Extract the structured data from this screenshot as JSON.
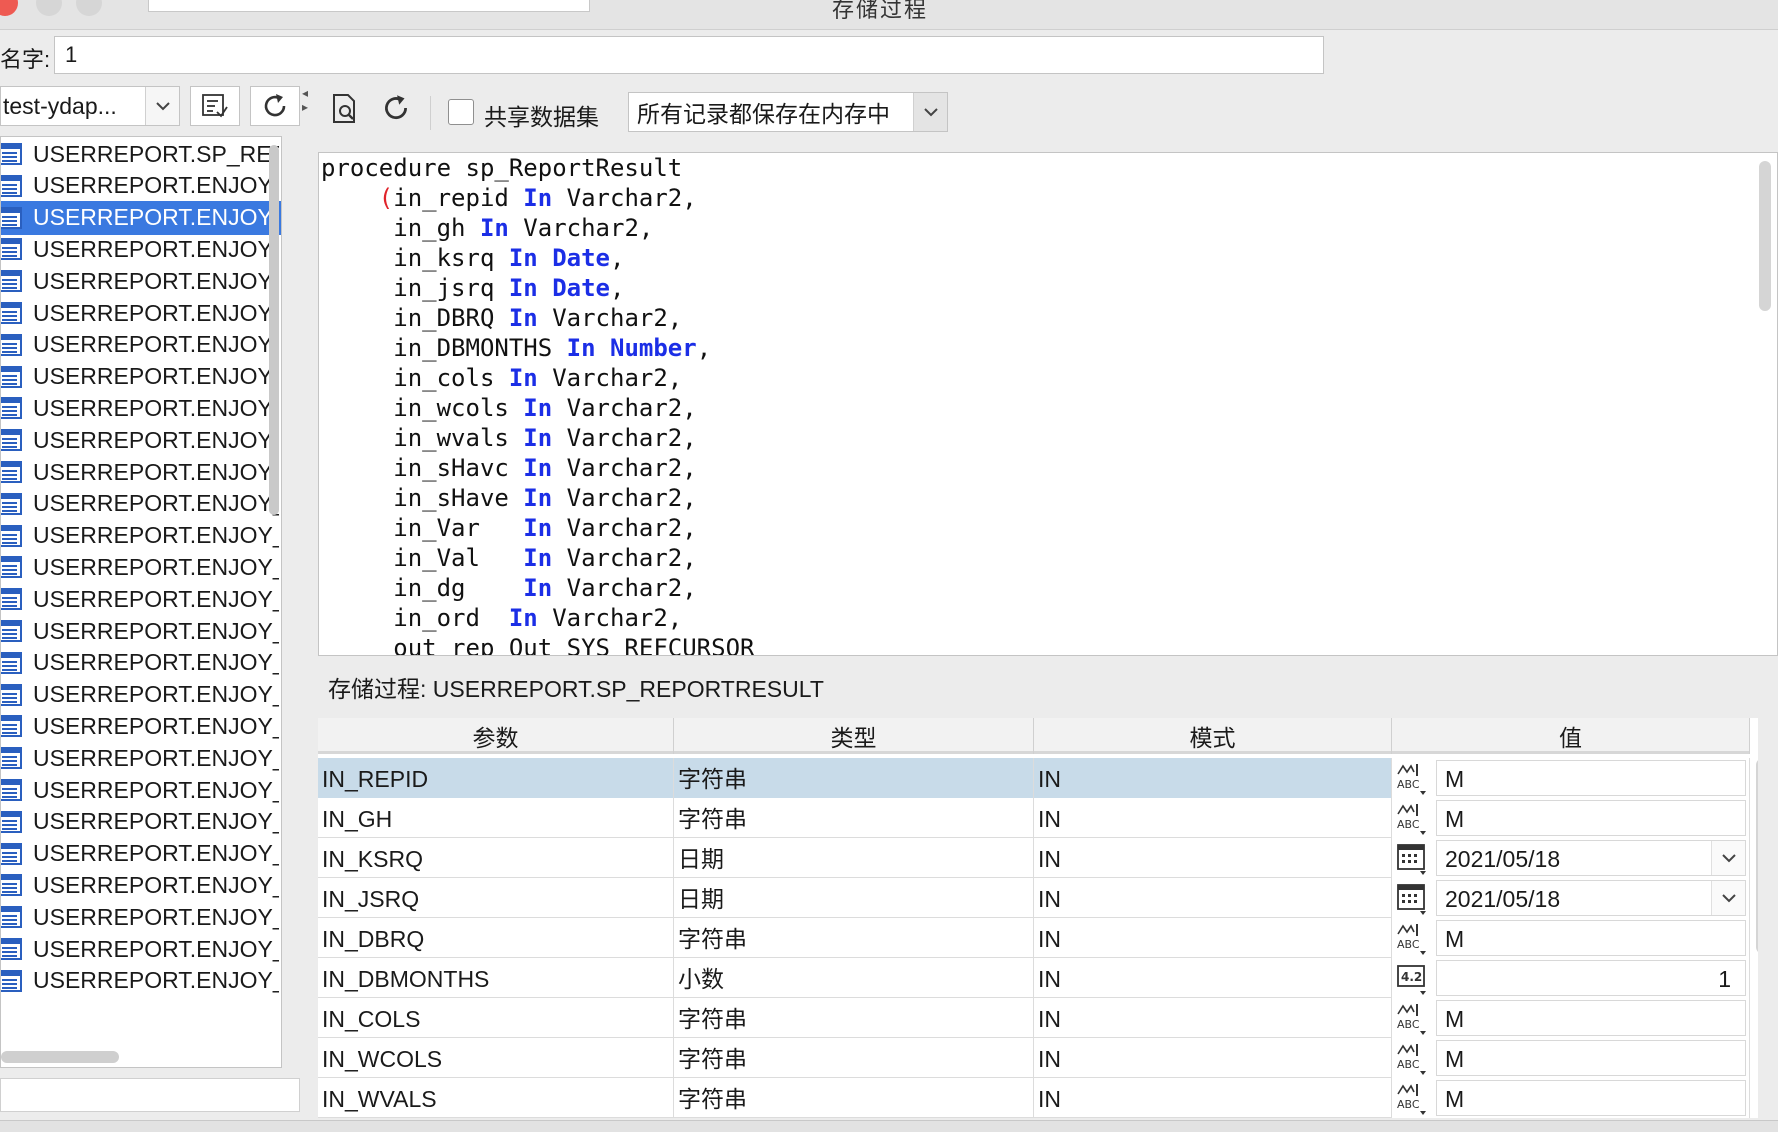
{
  "window": {
    "title": "存储过程"
  },
  "name_row": {
    "label": "名字:",
    "value": "1"
  },
  "left": {
    "connection": "test-ydap...",
    "tree_items": [
      "USERREPORT.SP_REPORTRESULT",
      "USERREPORT.ENJOY_",
      "USERREPORT.ENJOY_",
      "USERREPORT.ENJOY_",
      "USERREPORT.ENJOY_",
      "USERREPORT.ENJOY_",
      "USERREPORT.ENJOY_",
      "USERREPORT.ENJOY_",
      "USERREPORT.ENJOY_",
      "USERREPORT.ENJOY_",
      "USERREPORT.ENJOY_",
      "USERREPORT.ENJOY_",
      "USERREPORT.ENJOY_",
      "USERREPORT.ENJOY_",
      "USERREPORT.ENJOY_",
      "USERREPORT.ENJOY_",
      "USERREPORT.ENJOY_",
      "USERREPORT.ENJOY_",
      "USERREPORT.ENJOY_",
      "USERREPORT.ENJOY_",
      "USERREPORT.ENJOY_",
      "USERREPORT.ENJOY_",
      "USERREPORT.ENJOY_",
      "USERREPORT.ENJOY_",
      "USERREPORT.ENJOY_",
      "USERREPORT.ENJOY_",
      "USERREPORT.ENJOY_"
    ],
    "selected_index": 2,
    "bottom_filter": ""
  },
  "toolbar": {
    "share_label": "共享数据集",
    "memory_option": "所有记录都保存在内存中"
  },
  "code": {
    "lines": [
      [
        {
          "t": "procedure sp_ReportResult"
        }
      ],
      [
        {
          "t": "    "
        },
        {
          "t": "(",
          "c": "paren"
        },
        {
          "t": "in_repid "
        },
        {
          "t": "In",
          "c": "kw"
        },
        {
          "t": " Varchar2,"
        }
      ],
      [
        {
          "t": "     in_gh "
        },
        {
          "t": "In",
          "c": "kw"
        },
        {
          "t": " Varchar2,"
        }
      ],
      [
        {
          "t": "     in_ksrq "
        },
        {
          "t": "In Date",
          "c": "kw"
        },
        {
          "t": ","
        }
      ],
      [
        {
          "t": "     in_jsrq "
        },
        {
          "t": "In Date",
          "c": "kw"
        },
        {
          "t": ","
        }
      ],
      [
        {
          "t": "     in_DBRQ "
        },
        {
          "t": "In",
          "c": "kw"
        },
        {
          "t": " Varchar2,"
        }
      ],
      [
        {
          "t": "     in_DBMONTHS "
        },
        {
          "t": "In Number",
          "c": "kw"
        },
        {
          "t": ","
        }
      ],
      [
        {
          "t": "     in_cols "
        },
        {
          "t": "In",
          "c": "kw"
        },
        {
          "t": " Varchar2,"
        }
      ],
      [
        {
          "t": "     in_wcols "
        },
        {
          "t": "In",
          "c": "kw"
        },
        {
          "t": " Varchar2,"
        }
      ],
      [
        {
          "t": "     in_wvals "
        },
        {
          "t": "In",
          "c": "kw"
        },
        {
          "t": " Varchar2,"
        }
      ],
      [
        {
          "t": "     in_sHavc "
        },
        {
          "t": "In",
          "c": "kw"
        },
        {
          "t": " Varchar2,"
        }
      ],
      [
        {
          "t": "     in_sHave "
        },
        {
          "t": "In",
          "c": "kw"
        },
        {
          "t": " Varchar2,"
        }
      ],
      [
        {
          "t": "     in_Var   "
        },
        {
          "t": "In",
          "c": "kw"
        },
        {
          "t": " Varchar2,"
        }
      ],
      [
        {
          "t": "     in_Val   "
        },
        {
          "t": "In",
          "c": "kw"
        },
        {
          "t": " Varchar2,"
        }
      ],
      [
        {
          "t": "     in_dg    "
        },
        {
          "t": "In",
          "c": "kw"
        },
        {
          "t": " Varchar2,"
        }
      ],
      [
        {
          "t": "     in_ord  "
        },
        {
          "t": "In",
          "c": "kw"
        },
        {
          "t": " Varchar2,"
        }
      ],
      [
        {
          "t": "     out_rep Out SYS_REFCURSOR"
        }
      ]
    ]
  },
  "proc_caption": "存储过程: USERREPORT.SP_REPORTRESULT",
  "params": {
    "headers": [
      "参数",
      "类型",
      "模式",
      "值"
    ],
    "rows": [
      {
        "name": "IN_REPID",
        "type": "字符串",
        "mode": "IN",
        "icon": "text-abc-icon",
        "value": "M"
      },
      {
        "name": "IN_GH",
        "type": "字符串",
        "mode": "IN",
        "icon": "text-abc-icon",
        "value": "M"
      },
      {
        "name": "IN_KSRQ",
        "type": "日期",
        "mode": "IN",
        "icon": "calendar-icon",
        "value": "2021/05/18"
      },
      {
        "name": "IN_JSRQ",
        "type": "日期",
        "mode": "IN",
        "icon": "calendar-icon",
        "value": "2021/05/18"
      },
      {
        "name": "IN_DBRQ",
        "type": "字符串",
        "mode": "IN",
        "icon": "text-abc-icon",
        "value": "M"
      },
      {
        "name": "IN_DBMONTHS",
        "type": "小数",
        "mode": "IN",
        "icon": "decimal-number-icon",
        "value": "1"
      },
      {
        "name": "IN_COLS",
        "type": "字符串",
        "mode": "IN",
        "icon": "text-abc-icon",
        "value": "M"
      },
      {
        "name": "IN_WCOLS",
        "type": "字符串",
        "mode": "IN",
        "icon": "text-abc-icon",
        "value": "M"
      },
      {
        "name": "IN_WVALS",
        "type": "字符串",
        "mode": "IN",
        "icon": "text-abc-icon",
        "value": "M"
      }
    ],
    "selected_index": 0
  },
  "colors": {
    "selection": "#3a79e0",
    "row_selection": "#c8dbe9",
    "keyword": "#1b2ee6",
    "paren": "#e0232a",
    "close": "#ee5a52"
  }
}
